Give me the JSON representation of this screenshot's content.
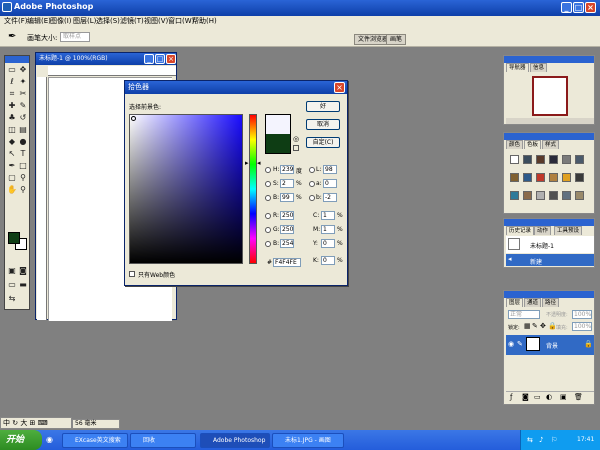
{
  "app": {
    "title": "Adobe Photoshop"
  },
  "menu": [
    "文件(F)",
    "编辑(E)",
    "图像(I)",
    "图层(L)",
    "选择(S)",
    "滤镜(T)",
    "视图(V)",
    "窗口(W)",
    "帮助(H)"
  ],
  "options": {
    "brush_label": "画笔大小:",
    "brush_value": "取样点"
  },
  "wells": {
    "file_browser": "文件浏览器",
    "brushes": "画笔"
  },
  "document": {
    "title": "未标题-1 @ 100%(RGB)"
  },
  "color_picker": {
    "title": "拾色器",
    "select_label": "选择前景色:",
    "ok": "好",
    "cancel": "取消",
    "custom": "自定(C)",
    "only_web": "只有Web颜色",
    "fields": {
      "H": "239",
      "S": "2",
      "B": "99",
      "R": "250",
      "G": "250",
      "Bb": "254",
      "L": "98",
      "a": "0",
      "b": "-2",
      "C": "1",
      "M": "1",
      "Y": "0",
      "K": "0"
    },
    "units": {
      "deg": "度",
      "pct": "%"
    },
    "hex": "F4F4FE",
    "new_color": "#f4f4fe",
    "current_color": "#0e3d14"
  },
  "toolbox": {
    "foreground": "#0e3d14",
    "background": "#ffffff"
  },
  "panels": {
    "navigator": {
      "tabs": [
        "导航器",
        "信息"
      ]
    },
    "swatches": {
      "tabs": [
        "颜色",
        "色板",
        "样式"
      ]
    },
    "history": {
      "tabs": [
        "历史记录",
        "动作",
        "工具预设"
      ],
      "items": [
        "未标题-1",
        "新建"
      ]
    },
    "layers": {
      "tabs": [
        "图层",
        "通道",
        "路径"
      ],
      "mode": "正常",
      "opacity_label": "不透明度:",
      "opacity": "100%",
      "lock_label": "锁定:",
      "fill_label": "填充:",
      "fill": "100%",
      "layer": "背景"
    }
  },
  "status": {
    "ime": "中 ↻ 大 ⊞ ⌨",
    "zoom": "56 毫米"
  },
  "taskbar": {
    "start": "开始",
    "tasks": [
      "EXcase英文搜索",
      "回收",
      "Adobe Photoshop",
      "未标1.JPG - 画图"
    ],
    "clock": "17:41"
  },
  "colors": {
    "titlebar": "#0e3fa8",
    "chrome": "#ece9d8",
    "workspace": "#808080"
  }
}
